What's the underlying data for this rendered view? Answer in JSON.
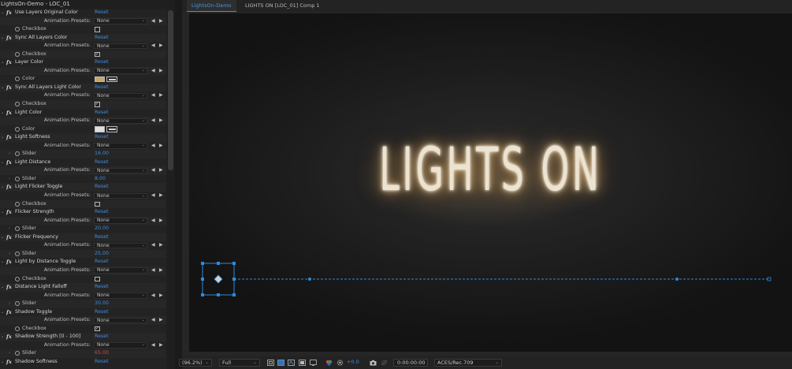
{
  "effect_controls": {
    "title": "LightsOn-Demo - LOC_01",
    "preset_label": "Animation Presets:",
    "preset_value": "None",
    "reset_label": "Reset",
    "effects": [
      {
        "name": "Use Layers Original Color",
        "prop_type": "checkbox",
        "prop_label": "Checkbox",
        "checked": false
      },
      {
        "name": "Sync All Layers Color",
        "prop_type": "checkbox",
        "prop_label": "Checkbox",
        "checked": true
      },
      {
        "name": "Layer Color",
        "prop_type": "color",
        "prop_label": "Color",
        "swatch": "#c8a66a"
      },
      {
        "name": "Sync All Layers Light Color",
        "prop_type": "checkbox",
        "prop_label": "Checkbox",
        "checked": true
      },
      {
        "name": "Light Color",
        "prop_type": "color",
        "prop_label": "Color",
        "swatch": "#dedede"
      },
      {
        "name": "Light Softness",
        "prop_type": "slider",
        "prop_label": "Slider",
        "value": "16.00"
      },
      {
        "name": "Light Distance",
        "prop_type": "slider",
        "prop_label": "Slider",
        "value": "8.00"
      },
      {
        "name": "Light Flicker Toggle",
        "prop_type": "checkbox",
        "prop_label": "Checkbox",
        "checked": false
      },
      {
        "name": "Flicker Strength",
        "prop_type": "slider",
        "prop_label": "Slider",
        "value": "20.00"
      },
      {
        "name": "Flicker Frequency",
        "prop_type": "slider",
        "prop_label": "Slider",
        "value": "25.00"
      },
      {
        "name": "Light by Distance Toggle",
        "prop_type": "checkbox",
        "prop_label": "Checkbox",
        "checked": false
      },
      {
        "name": "Distance Light Falloff",
        "prop_type": "slider",
        "prop_label": "Slider",
        "value": "30.00"
      },
      {
        "name": "Shadow Toggle",
        "prop_type": "checkbox",
        "prop_label": "Checkbox",
        "checked": true
      },
      {
        "name": "Shadow Strength [0 - 100]",
        "prop_type": "slider",
        "prop_label": "Slider",
        "value": "65.00",
        "value_color": "red"
      },
      {
        "name": "Shadow Softness",
        "prop_type": "none"
      }
    ]
  },
  "composition": {
    "tabs": [
      "LightsOn-Demo",
      "LIGHTS ON [LOC_01] Comp 1"
    ],
    "canvas_text": "LIGHTS ON"
  },
  "status_bar": {
    "zoom": "(96.2%)",
    "resolution": "Full",
    "exposure": "+0.0",
    "timecode": "0:00:00:00",
    "color_space": "ACES/Rec.709"
  },
  "colors": {
    "accent": "#3f8de0",
    "warning_value": "#d34a4a",
    "handle": "#2d8ad8"
  },
  "icons": [
    "twirl-arrow-icon",
    "fx-icon",
    "stopwatch-icon",
    "keyframe-prev-icon",
    "keyframe-next-icon",
    "eyedropper-icon",
    "checkbox-icon",
    "snapshot-icon",
    "color-wheel-icon",
    "exposure-reset-icon",
    "region-of-interest-icon",
    "transparency-grid-icon",
    "mask-toggle-icon",
    "guides-icon",
    "channel-icon"
  ]
}
